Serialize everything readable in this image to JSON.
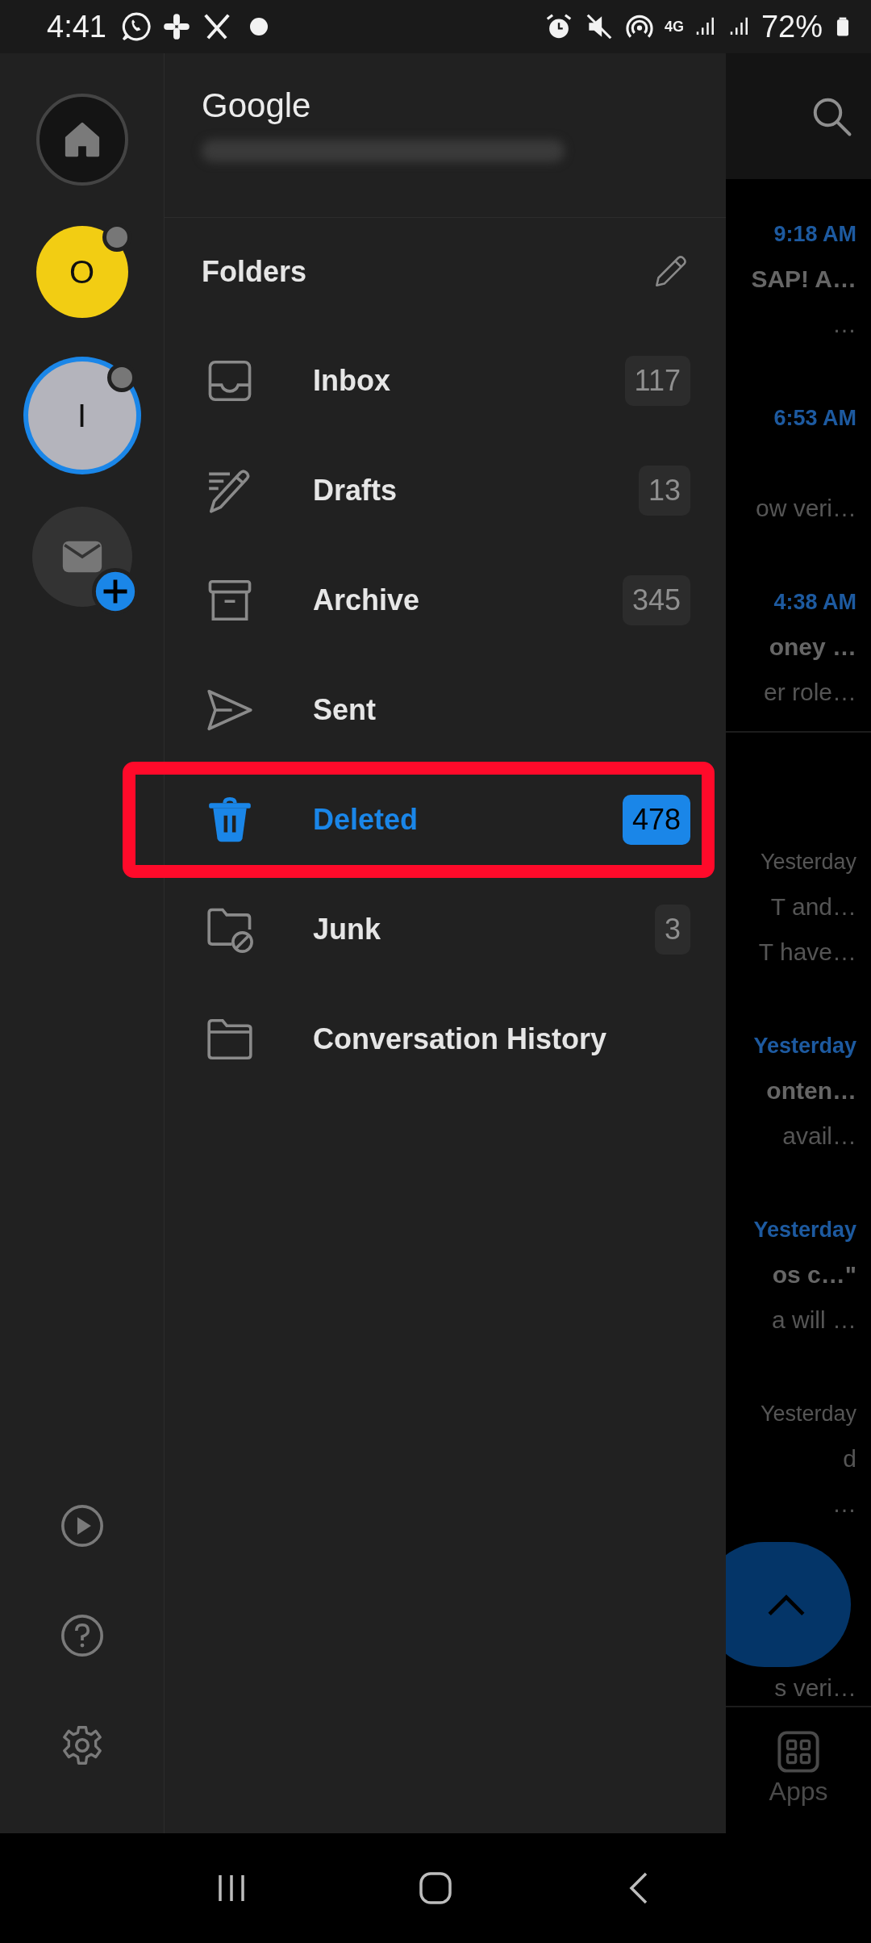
{
  "status_bar": {
    "time": "4:41",
    "network": "4G",
    "battery": "72%"
  },
  "account_header": {
    "provider": "Google"
  },
  "accounts": [
    {
      "initial": "O",
      "color": "#f2cd13",
      "selected": false
    },
    {
      "initial": "I",
      "color": "#b4b4bc",
      "selected": true
    }
  ],
  "folders_title": "Folders",
  "folders": [
    {
      "name": "Inbox",
      "kind": "inbox",
      "count": "117",
      "selected": false,
      "highlighted": false
    },
    {
      "name": "Drafts",
      "kind": "drafts",
      "count": "13",
      "selected": false,
      "highlighted": false
    },
    {
      "name": "Archive",
      "kind": "archive",
      "count": "345",
      "selected": false,
      "highlighted": false
    },
    {
      "name": "Sent",
      "kind": "sent",
      "selected": false,
      "highlighted": false
    },
    {
      "name": "Deleted",
      "kind": "deleted",
      "count": "478",
      "selected": true,
      "highlighted": true
    },
    {
      "name": "Junk",
      "kind": "junk",
      "count": "3",
      "selected": false,
      "highlighted": false
    },
    {
      "name": "Conversation History",
      "kind": "folder",
      "selected": false,
      "highlighted": false
    }
  ],
  "background_messages": [
    {
      "time": "9:18 AM",
      "unread": true,
      "subject": "SAP! A…",
      "preview": "…"
    },
    {
      "time": "6:53 AM",
      "unread": true,
      "preview": "ow veri…"
    },
    {
      "time": "4:38 AM",
      "unread": true,
      "subject": "oney …",
      "preview": "er role…"
    },
    {
      "time": "Yesterday",
      "unread": false,
      "subject": "T and…",
      "preview": "T have…"
    },
    {
      "time": "Yesterday",
      "unread": true,
      "subject": "onten…",
      "preview": " avail…"
    },
    {
      "time": "Yesterday",
      "unread": true,
      "subject": "os c…\"",
      "preview": "a will …"
    },
    {
      "time": "Yesterday",
      "unread": false,
      "subject": "d",
      "preview": "…"
    },
    {
      "preview": "s veri…"
    }
  ],
  "bottom_tab": {
    "label": "Apps"
  }
}
